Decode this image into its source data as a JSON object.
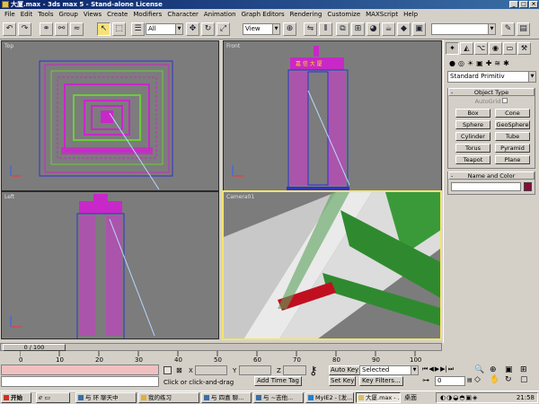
{
  "window": {
    "title": "大厦.max - 3ds max 5 - Stand-alone License",
    "buttons": [
      "_",
      "□",
      "×"
    ]
  },
  "menu": [
    "File",
    "Edit",
    "Tools",
    "Group",
    "Views",
    "Create",
    "Modifiers",
    "Character",
    "Animation",
    "Graph Editors",
    "Rendering",
    "Customize",
    "MAXScript",
    "Help"
  ],
  "toolbar": {
    "selection_filter": "All",
    "ref_coord": "View"
  },
  "viewports": {
    "top": "Top",
    "front": "Front",
    "left": "Left",
    "camera": "Camera01",
    "sign_text": "嘉 信 大 厦"
  },
  "command_panel": {
    "tabs": [
      "create-tab",
      "modify-tab",
      "hierarchy-tab",
      "motion-tab",
      "display-tab",
      "utilities-tab"
    ],
    "category_icons": [
      "geometry",
      "shapes",
      "lights",
      "cameras",
      "helpers",
      "spacewarps",
      "systems"
    ],
    "category": "Standard Primitiv",
    "object_type_title": "Object Type",
    "autogrid": "AutoGrid",
    "buttons": [
      "Box",
      "Cone",
      "Sphere",
      "GeoSphere",
      "Cylinder",
      "Tube",
      "Torus",
      "Pyramid",
      "Teapot",
      "Plane"
    ],
    "name_color_title": "Name and Color",
    "object_color": "#8b0a3a"
  },
  "timeline": {
    "slider": "0 / 100",
    "ticks": [
      "0",
      "10",
      "20",
      "30",
      "40",
      "50",
      "60",
      "70",
      "80",
      "90",
      "100"
    ]
  },
  "status": {
    "prompt": "Click or click-and-drag",
    "add_time_tag": "Add Time Tag",
    "x_label": "X",
    "y_label": "Y",
    "z_label": "Z",
    "auto_key": "Auto Key",
    "set_key": "Set Key",
    "selected": "Selected",
    "key_filters": "Key Filters...",
    "frame": "0"
  },
  "taskbar": {
    "start": "开始",
    "tasks": [
      "与 环 聊天中",
      "我的练习",
      "与 四喜 聊...",
      "与 ~吉他...",
      "MyIE2 - [发...",
      "大厦.max - ..."
    ],
    "desktop": "桌面",
    "clock": "21:58"
  },
  "colors": {
    "magenta": "#c828c8",
    "green": "#6ccc3c",
    "select_yellow": "#f4e46c",
    "bg_grey": "#7c7c7c"
  }
}
